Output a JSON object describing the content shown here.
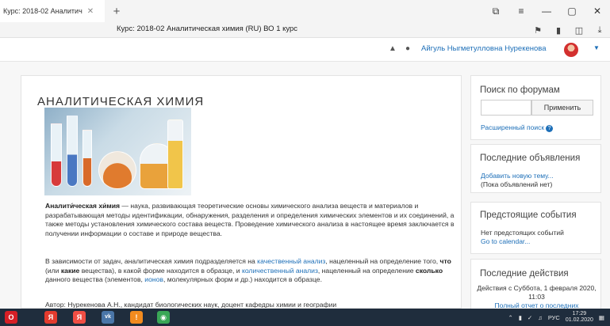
{
  "browser": {
    "tab_title": "Курс: 2018-02 Аналитич",
    "tab_close_glyph": "✕",
    "newtab_glyph": "+",
    "address_text": "Курс: 2018-02 Аналитическая химия (RU) ВО 1 курс",
    "window_controls": [
      "⧉",
      "≡",
      "—",
      "▢",
      "✕"
    ],
    "toolbar_icons": [
      "bookmark-icon",
      "battery-icon",
      "extension-icon",
      "download-icon"
    ]
  },
  "navbar": {
    "user_name": "Айгуль Ныгметулловна Нуреке нова",
    "user_name_display": "Айгуль Ныгметулловна Нурекенова"
  },
  "course": {
    "title": "АНАЛИТИЧЕСКАЯ ХИМИЯ",
    "p1_term": "Аналити́ческая хи́мия",
    "p1_text": " — наука, развивающая теоретические основы химического анализа веществ и материалов и разрабатывающая методы идентификации, обнаружения, разделения и определения химических элементов и их соединений, а также методы установления химического состава веществ. Проведение химического анализа в настоящее время заключается в получении информации о составе и природе вещества.",
    "p2_a": "В зависимости от задач, аналитическая химия подразделяется на ",
    "p2_link1": "качественный анализ",
    "p2_b": ", нацеленный на определение того, ",
    "p2_what": "что",
    "p2_c": " (или ",
    "p2_which": "какие",
    "p2_d": " вещества), в какой форме находится в образце, и ",
    "p2_link2": "количественный анализ",
    "p2_e": ", нацеленный на определение ",
    "p2_howmuch": "сколько",
    "p2_f": " данного вещества (элементов, ",
    "p2_link3": "ионов",
    "p2_g": ", молекулярных форм и др.) находится в образце.",
    "p3": "Автор: Нурекенова А.Н., кандидат биологических наук, доцент кафедры химии и географии"
  },
  "blocks": {
    "forum_search": {
      "title": "Поиск по форумам",
      "input_value": "",
      "apply_label": "Применить",
      "advanced_label": "Расширенный поиск",
      "help_glyph": "?"
    },
    "news": {
      "title": "Последние объявления",
      "add_label": "Добавить новую тему...",
      "note": "(Пока объявлений нет)"
    },
    "upcoming": {
      "title": "Предстоящие события",
      "note": "Нет предстоящих событий",
      "calendar_label": "Go to calendar..."
    },
    "recent": {
      "title": "Последние действия",
      "activity": "Действия с Суббота, 1 февраля 2020, 11:03",
      "full_report": "Полный отчет о последних"
    }
  },
  "taskbar": {
    "apps": [
      {
        "name": "opera-icon",
        "glyph": "O",
        "color": "#d61f26"
      },
      {
        "name": "yandex-icon",
        "glyph": "Я",
        "color": "#e33b2e"
      },
      {
        "name": "yandex-browser-icon",
        "glyph": "Я",
        "color": "#f04e44"
      },
      {
        "name": "vk-icon",
        "glyph": "vk",
        "color": "#4a76a8"
      },
      {
        "name": "pdf-icon",
        "glyph": "!",
        "color": "#f28b1f"
      },
      {
        "name": "chrome-icon",
        "glyph": "◉",
        "color": "#3aa757"
      }
    ],
    "lang": "РУС",
    "time": "17:29",
    "date": "01.02.2020"
  }
}
